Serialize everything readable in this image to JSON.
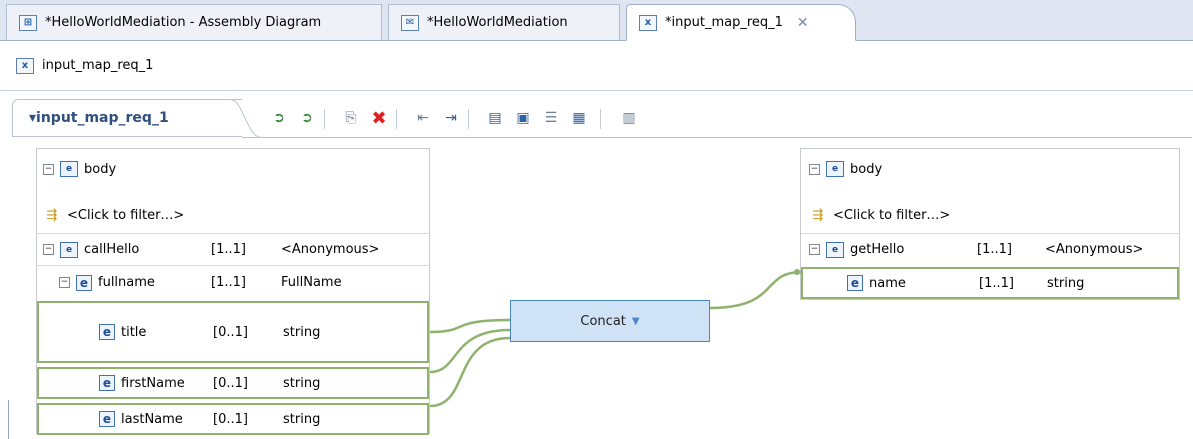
{
  "tabs": [
    {
      "label": "*HelloWorldMediation - Assembly Diagram",
      "icon": "assembly-diagram-icon"
    },
    {
      "label": "*HelloWorldMediation",
      "icon": "mediation-flow-icon"
    },
    {
      "label": "*input_map_req_1",
      "icon": "xsl-map-icon",
      "close": "✕"
    }
  ],
  "editor": {
    "title": "input_map_req_1"
  },
  "toolbar": {
    "map_name": "▾input_map_req_1"
  },
  "source": {
    "root": "body",
    "filter": "<Click to filter…>",
    "rows": [
      {
        "name": "callHello",
        "card": "[1..1]",
        "type": "<Anonymous>"
      },
      {
        "name": "fullname",
        "card": "[1..1]",
        "type": "FullName"
      },
      {
        "name": "title",
        "card": "[0..1]",
        "type": "string"
      },
      {
        "name": "firstName",
        "card": "[0..1]",
        "type": "string"
      },
      {
        "name": "lastName",
        "card": "[0..1]",
        "type": "string"
      }
    ]
  },
  "target": {
    "root": "body",
    "filter": "<Click to filter…>",
    "rows": [
      {
        "name": "getHello",
        "card": "[1..1]",
        "type": "<Anonymous>"
      },
      {
        "name": "name",
        "card": "[1..1]",
        "type": "string"
      }
    ]
  },
  "transform": {
    "label": "Concat",
    "caret": "▼"
  },
  "colors": {
    "connector": "#8fb36f",
    "transform_fill": "#cfe2f6",
    "tab_bar": "#dfe6f1"
  }
}
